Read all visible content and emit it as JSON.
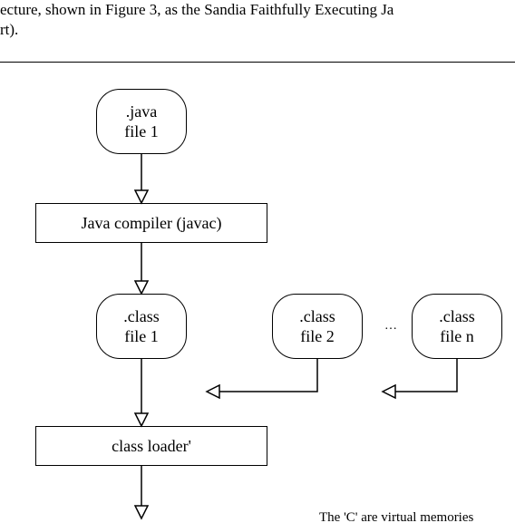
{
  "text": {
    "frag1": "ecture, shown in Figure 3, as the Sandia Faithfully Executing Ja",
    "frag2": "rt).",
    "frag3": "The 'C' are virtual memories"
  },
  "diagram": {
    "java_file": {
      "line1": ".java",
      "line2": "file 1"
    },
    "compiler": "Java compiler (javac)",
    "class1": {
      "line1": ".class",
      "line2": "file 1"
    },
    "class2": {
      "line1": ".class",
      "line2": "file 2"
    },
    "classn": {
      "line1": ".class",
      "line2": "file n"
    },
    "ellipsis": "…",
    "loader": "class loader'"
  },
  "chart_data": {
    "type": "flowchart",
    "nodes": [
      {
        "id": "java_file",
        "label": ".java file 1",
        "shape": "rounded"
      },
      {
        "id": "compiler",
        "label": "Java compiler (javac)",
        "shape": "rect"
      },
      {
        "id": "class1",
        "label": ".class file 1",
        "shape": "rounded"
      },
      {
        "id": "class2",
        "label": ".class file 2",
        "shape": "rounded"
      },
      {
        "id": "classn",
        "label": ".class file n",
        "shape": "rounded"
      },
      {
        "id": "loader",
        "label": "class loader'",
        "shape": "rect"
      }
    ],
    "edges": [
      {
        "from": "java_file",
        "to": "compiler"
      },
      {
        "from": "compiler",
        "to": "class1"
      },
      {
        "from": "class1",
        "to": "loader"
      },
      {
        "from": "class2",
        "to": "loader"
      },
      {
        "from": "classn",
        "to": "loader"
      },
      {
        "from": "loader",
        "to": "below"
      }
    ],
    "note": "ellipsis between class2 and classn indicates repetition"
  }
}
